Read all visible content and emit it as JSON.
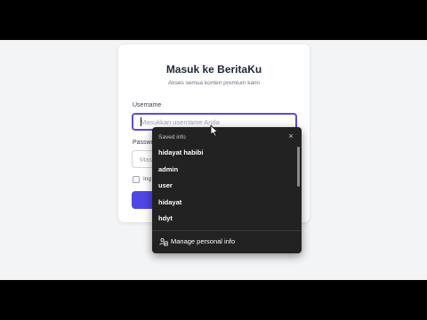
{
  "card": {
    "title": "Masuk ke BeritaKu",
    "subtitle": "Akses semua konten premium kami"
  },
  "form": {
    "username_label": "Username",
    "username_placeholder": "Masukkan username Anda",
    "password_label": "Passwo",
    "password_placeholder": "Mas",
    "remember_label": "Ing",
    "submit_label": ""
  },
  "autofill": {
    "header": "Saved info",
    "close_glyph": "×",
    "items": [
      "hidayat habibi",
      "admin",
      "user",
      "hidayat",
      "hdyt"
    ],
    "manage_label": "Manage personal info"
  },
  "colors": {
    "accent": "#4f46e5",
    "focus_border": "#5b4bd6",
    "popup_bg": "#222222",
    "page_bg": "#f3f4f6"
  },
  "icons": {
    "manage": "person-card-icon",
    "cursor": "mouse-pointer-icon"
  }
}
